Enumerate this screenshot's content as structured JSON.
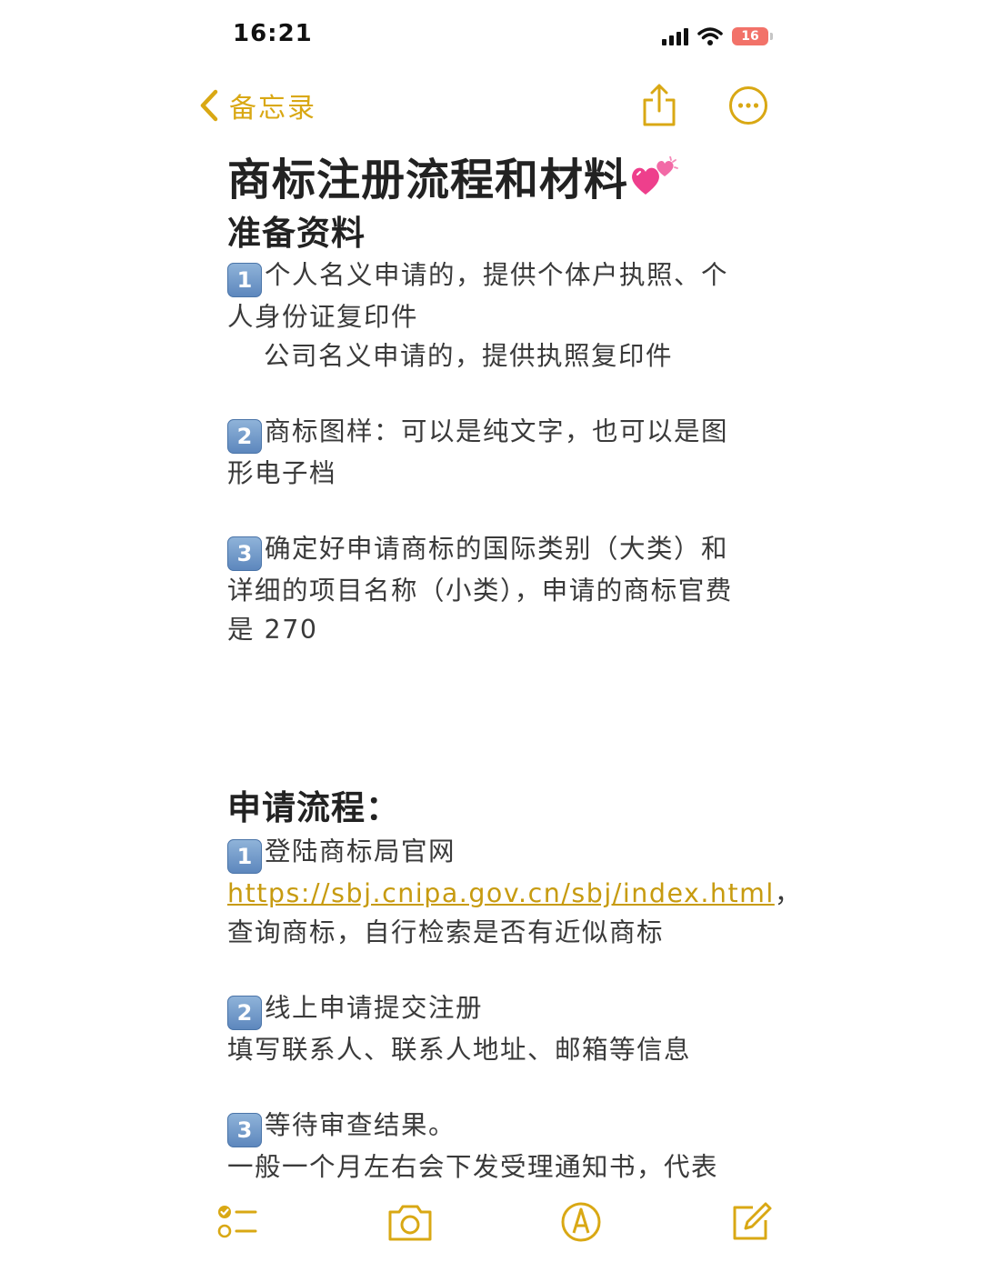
{
  "status_bar": {
    "time": "16:21",
    "battery": "16",
    "icons": [
      "signal-icon",
      "wifi-icon",
      "battery-icon"
    ]
  },
  "nav": {
    "back_label": "备忘录",
    "icons": [
      "chevron-left-icon",
      "share-icon",
      "more-icon"
    ]
  },
  "accent_color": "#d9a814",
  "note": {
    "title": "商标注册流程和材料",
    "title_emoji": "two-hearts-icon",
    "section1": {
      "heading": "准备资料",
      "items": [
        {
          "num": "1",
          "text": "个人名义申请的，提供个体户执照、个人身份证复印件",
          "extra": "公司名义申请的，提供执照复印件"
        },
        {
          "num": "2",
          "text": "商标图样：可以是纯文字，也可以是图形电子档"
        },
        {
          "num": "3",
          "text": "确定好申请商标的国际类别（大类）和详细的项目名称（小类），申请的商标官费是 270"
        }
      ]
    },
    "section2": {
      "heading": "申请流程：",
      "items": [
        {
          "num": "1",
          "prefix": "登陆商标局官网 ",
          "link": "https://sbj.cnipa.gov.cn/sbj/index.html",
          "suffix": "，查询商标，自行检索是否有近似商标"
        },
        {
          "num": "2",
          "text": "线上申请提交注册",
          "extra": "填写联系人、联系人地址、邮箱等信息"
        },
        {
          "num": "3",
          "text": "等待审查结果。",
          "extra": "一般一个月左右会下发受理通知书，代表"
        }
      ]
    }
  },
  "toolbar": {
    "icons": [
      "checklist-icon",
      "camera-icon",
      "markup-icon",
      "compose-icon"
    ]
  }
}
